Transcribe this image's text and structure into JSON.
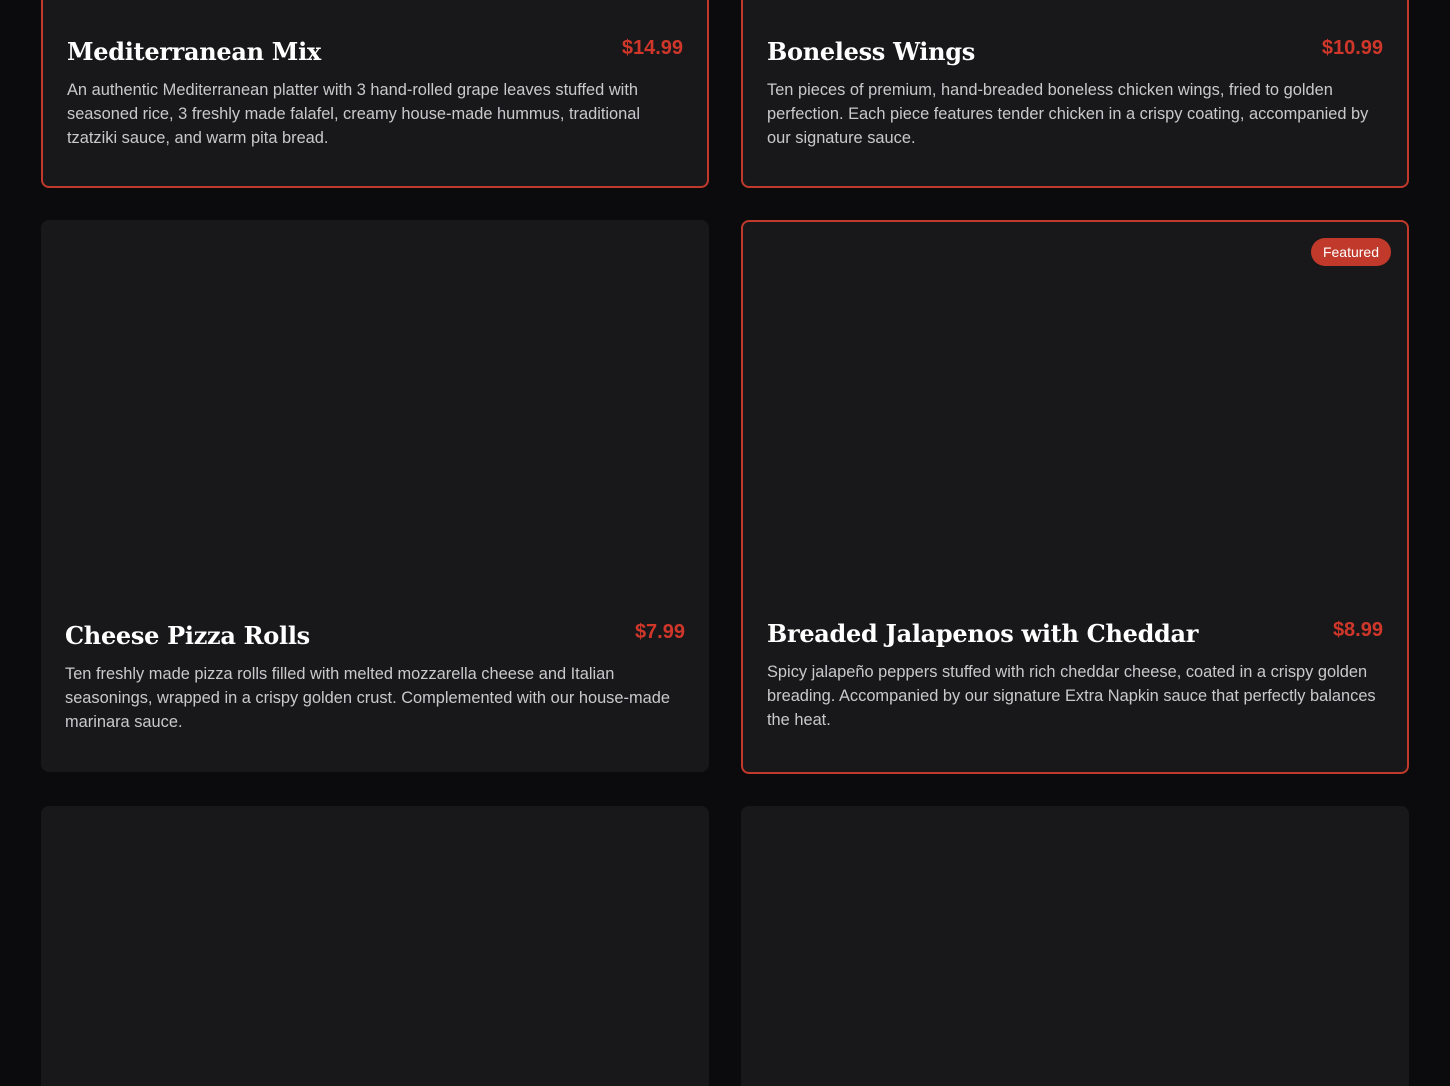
{
  "menu_items": [
    {
      "name": "Mediterranean Mix",
      "price": "$14.99",
      "description": "An authentic Mediterranean platter with 3 hand-rolled grape leaves stuffed with seasoned rice, 3 freshly made falafel, creamy house-made hummus, traditional tzatziki sauce, and warm pita bread."
    },
    {
      "name": "Boneless Wings",
      "price": "$10.99",
      "description": "Ten pieces of premium, hand-breaded boneless chicken wings, fried to golden perfection. Each piece features tender chicken in a crispy coating, accompanied by our signature sauce."
    },
    {
      "name": "Cheese Pizza Rolls",
      "price": "$7.99",
      "description": "Ten freshly made pizza rolls filled with melted mozzarella cheese and Italian seasonings, wrapped in a crispy golden crust. Complemented with our house-made marinara sauce."
    },
    {
      "name": "Breaded Jalapenos with Cheddar",
      "price": "$8.99",
      "description": "Spicy jalapeño peppers stuffed with rich cheddar cheese, coated in a crispy golden breading. Accompanied by our signature Extra Napkin sauce that perfectly balances the heat.",
      "badge": "Featured"
    }
  ],
  "colors": {
    "background": "#0b0b0d",
    "card": "#18181a",
    "accent": "#c0392b",
    "price": "#d0372a",
    "title": "#ffffff",
    "text": "#c9c9cc"
  }
}
